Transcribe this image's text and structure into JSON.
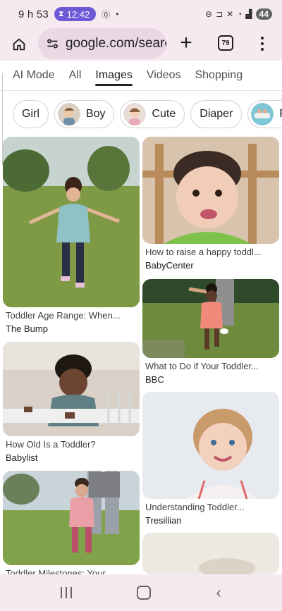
{
  "status": {
    "time": "9 h 53",
    "timer": "12:42",
    "battery": "44"
  },
  "browser": {
    "url": "google.com/searc",
    "tab_count": "79"
  },
  "search_tabs": [
    {
      "label": "AI Mode"
    },
    {
      "label": "All"
    },
    {
      "label": "Images"
    },
    {
      "label": "Videos"
    },
    {
      "label": "Shopping"
    }
  ],
  "chips": [
    {
      "label": "Girl"
    },
    {
      "label": "Boy"
    },
    {
      "label": "Cute"
    },
    {
      "label": "Diaper"
    },
    {
      "label": "F"
    }
  ],
  "results": [
    {
      "title": "Toddler Age Range: When...",
      "source": "The Bump"
    },
    {
      "title": "How to raise a happy toddl...",
      "source": "BabyCenter"
    },
    {
      "title": "What to Do if Your Toddler...",
      "source": "BBC"
    },
    {
      "title": "How Old Is a Toddler?",
      "source": "Babylist"
    },
    {
      "title": "Understanding Toddler...",
      "source": "Tresillian"
    },
    {
      "title": "Toddler Milestones: Your",
      "source": ""
    }
  ]
}
